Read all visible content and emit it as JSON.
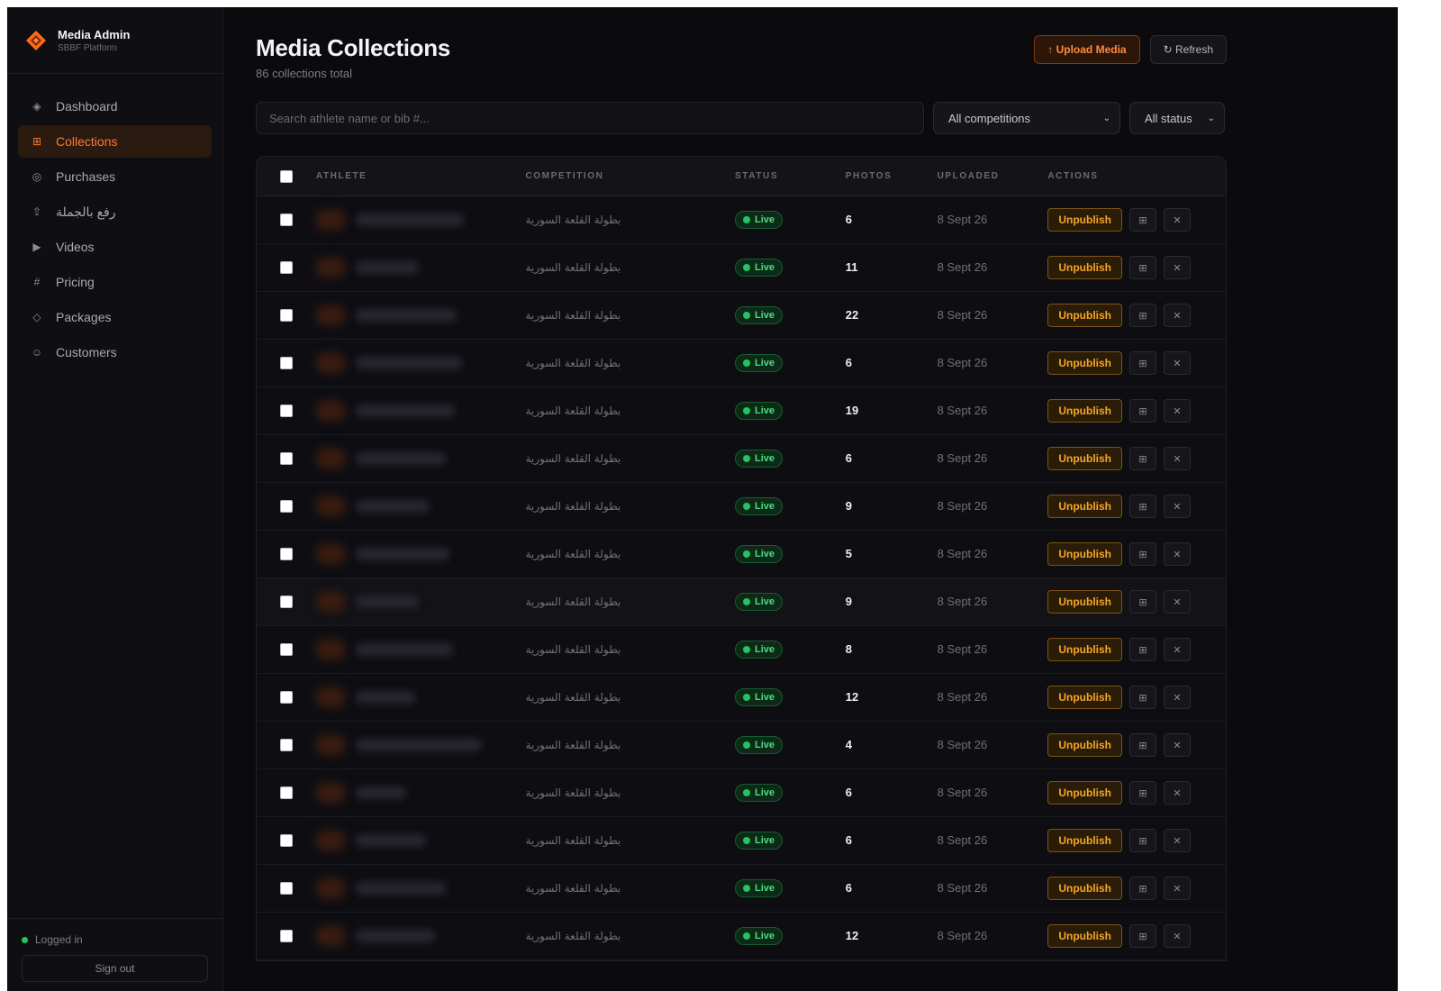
{
  "sidebar": {
    "brand_title": "Media Admin",
    "brand_subtitle": "SBBF Platform",
    "items": [
      {
        "label": "Dashboard",
        "icon": "diamond-icon",
        "glyph": "◈",
        "active": false
      },
      {
        "label": "Collections",
        "icon": "grid-icon",
        "glyph": "⊞",
        "active": true
      },
      {
        "label": "Purchases",
        "icon": "circle-icon",
        "glyph": "◎",
        "active": false
      },
      {
        "label": "رفع بالجملة",
        "icon": "upload-icon",
        "glyph": "⇪",
        "active": false
      },
      {
        "label": "Videos",
        "icon": "play-icon",
        "glyph": "▶",
        "active": false
      },
      {
        "label": "Pricing",
        "icon": "hash-icon",
        "glyph": "#",
        "active": false
      },
      {
        "label": "Packages",
        "icon": "package-icon",
        "glyph": "◇",
        "active": false
      },
      {
        "label": "Customers",
        "icon": "user-circle-icon",
        "glyph": "☺",
        "active": false
      }
    ],
    "status_text": "Logged in",
    "signout_label": "Sign out"
  },
  "header": {
    "title": "Media Collections",
    "subtitle": "86 collections total",
    "upload_label": "↑ Upload Media",
    "refresh_label": "↻ Refresh"
  },
  "filters": {
    "search_placeholder": "Search athlete name or bib #...",
    "competition_value": "All competitions",
    "status_value": "All status"
  },
  "table": {
    "columns": [
      "ATHLETE",
      "COMPETITION",
      "STATUS",
      "PHOTOS",
      "UPLOADED",
      "ACTIONS"
    ],
    "rows": [
      {
        "competition": "بطولة القلعة السورية",
        "status": "Live",
        "photos": "6",
        "uploaded": "8 Sept 26",
        "action": "Unpublish"
      },
      {
        "competition": "بطولة القلعة السورية",
        "status": "Live",
        "photos": "11",
        "uploaded": "8 Sept 26",
        "action": "Unpublish"
      },
      {
        "competition": "بطولة القلعة السورية",
        "status": "Live",
        "photos": "22",
        "uploaded": "8 Sept 26",
        "action": "Unpublish"
      },
      {
        "competition": "بطولة القلعة السورية",
        "status": "Live",
        "photos": "6",
        "uploaded": "8 Sept 26",
        "action": "Unpublish"
      },
      {
        "competition": "بطولة القلعة السورية",
        "status": "Live",
        "photos": "19",
        "uploaded": "8 Sept 26",
        "action": "Unpublish"
      },
      {
        "competition": "بطولة القلعة السورية",
        "status": "Live",
        "photos": "6",
        "uploaded": "8 Sept 26",
        "action": "Unpublish"
      },
      {
        "competition": "بطولة القلعة السورية",
        "status": "Live",
        "photos": "9",
        "uploaded": "8 Sept 26",
        "action": "Unpublish"
      },
      {
        "competition": "بطولة القلعة السورية",
        "status": "Live",
        "photos": "5",
        "uploaded": "8 Sept 26",
        "action": "Unpublish"
      },
      {
        "competition": "بطولة القلعة السورية",
        "status": "Live",
        "photos": "9",
        "uploaded": "8 Sept 26",
        "action": "Unpublish"
      },
      {
        "competition": "بطولة القلعة السورية",
        "status": "Live",
        "photos": "8",
        "uploaded": "8 Sept 26",
        "action": "Unpublish"
      },
      {
        "competition": "بطولة القلعة السورية",
        "status": "Live",
        "photos": "12",
        "uploaded": "8 Sept 26",
        "action": "Unpublish"
      },
      {
        "competition": "بطولة القلعة السورية",
        "status": "Live",
        "photos": "4",
        "uploaded": "8 Sept 26",
        "action": "Unpublish"
      },
      {
        "competition": "بطولة القلعة السورية",
        "status": "Live",
        "photos": "6",
        "uploaded": "8 Sept 26",
        "action": "Unpublish"
      },
      {
        "competition": "بطولة القلعة السورية",
        "status": "Live",
        "photos": "6",
        "uploaded": "8 Sept 26",
        "action": "Unpublish"
      },
      {
        "competition": "بطولة القلعة السورية",
        "status": "Live",
        "photos": "6",
        "uploaded": "8 Sept 26",
        "action": "Unpublish"
      },
      {
        "competition": "بطولة القلعة السورية",
        "status": "Live",
        "photos": "12",
        "uploaded": "8 Sept 26",
        "action": "Unpublish"
      }
    ]
  },
  "colors": {
    "accent": "#ff7a2e",
    "live_green": "#22c55e",
    "unpublish_amber": "#f5a524",
    "background": "#0b0b0e"
  }
}
